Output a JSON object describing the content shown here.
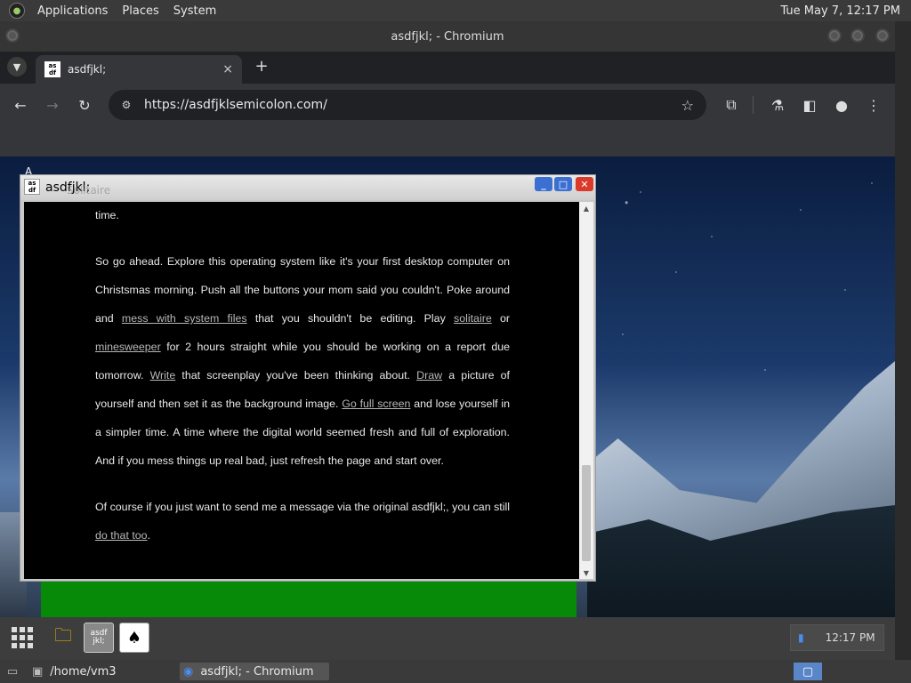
{
  "system_panel": {
    "menus": [
      "Applications",
      "Places",
      "System"
    ],
    "clock": "Tue May  7, 12:17 PM"
  },
  "browser": {
    "window_title": "asdfjkl; - Chromium",
    "tab_title": "asdfjkl;",
    "tab_close": "×",
    "new_tab": "+",
    "url": "https://asdfjklsemicolon.com/",
    "favicon_text": "as df"
  },
  "inner_window": {
    "title": "asdfjkl;",
    "ghost_title": "Solitaire",
    "paragraphs": {
      "p0": "time.",
      "p1": {
        "t1": "So go ahead. Explore this operating system like it's your first desktop computer on Christsmas morning. Push all the buttons your mom said you couldn't. Poke around and ",
        "l1": "mess with system files",
        "t2": " that you shouldn't be editing. Play ",
        "l2": "solitaire",
        "t3": " or ",
        "l3": "minesweeper",
        "t4": " for 2 hours straight while you should be working on a report due tomorrow. ",
        "l4": "Write",
        "t5": " that screenplay you've been thinking about. ",
        "l5": "Draw",
        "t6": " a picture of yourself and then set it as the background image. ",
        "l6": "Go full screen",
        "t7": " and lose yourself in a simpler time. A time where the digital world seemed fresh and full of exploration. And if you mess things up real bad, just refresh the page and start over."
      },
      "p2": {
        "t1": "Of course if you just want to send me a message via the original asdfjkl;, you can still ",
        "l1": "do that too",
        "t2": "."
      }
    }
  },
  "dock": {
    "clock": "12:17 PM",
    "app_label": "asdf jkl;"
  },
  "taskbar": {
    "items": [
      "/home/vm3",
      "asdfjkl; - Chromium"
    ]
  },
  "colors": {
    "green_bar": "#078a07",
    "close_btn": "#d93a2a",
    "window_btn": "#3b6fd1"
  }
}
